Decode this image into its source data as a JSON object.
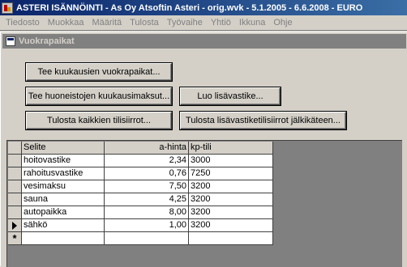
{
  "app": {
    "title": "ASTERI ISÄNNÖINTI - As Oy Atsoftin Asteri - orig.wvk - 5.1.2005 - 6.6.2008 - EURO"
  },
  "menu": [
    "Tiedosto",
    "Muokkaa",
    "Määritä",
    "Tulosta",
    "Työvaihe",
    "Yhtiö",
    "Ikkuna",
    "Ohje"
  ],
  "window": {
    "title": "Vuokrapaikat"
  },
  "buttons": {
    "monthly_rents": "Tee kuukausien vuokrapaikat...",
    "room_payments": "Tee huoneistojen kuukausimaksut...",
    "create_extra": "Luo lisävastike...",
    "print_transfers": "Tulosta kaikkien tilisiirrot...",
    "print_extra_transfers": "Tulosta lisävastiketilisiirrot jälkikäteen..."
  },
  "table": {
    "headers": [
      "Selite",
      "a-hinta",
      "kp-tili"
    ],
    "rows": [
      [
        "hoitovastike",
        "2,34",
        "3000"
      ],
      [
        "rahoitusvastike",
        "0,76",
        "7250"
      ],
      [
        "vesimaksu",
        "7,50",
        "3200"
      ],
      [
        "sauna",
        "4,25",
        "3200"
      ],
      [
        "autopaikka",
        "8,00",
        "3200"
      ],
      [
        "sähkö",
        "1,00",
        "3200"
      ]
    ],
    "current_row_index": 5,
    "new_row_marker": "*"
  },
  "icons": {
    "app": "app-logo-icon",
    "window": "form-icon",
    "current_row": "row-pointer-icon"
  },
  "colors": {
    "titlebar_start": "#0a246a",
    "titlebar_end": "#3a6ea5",
    "inactive_title": "#808080",
    "face": "#d4d0c8"
  }
}
